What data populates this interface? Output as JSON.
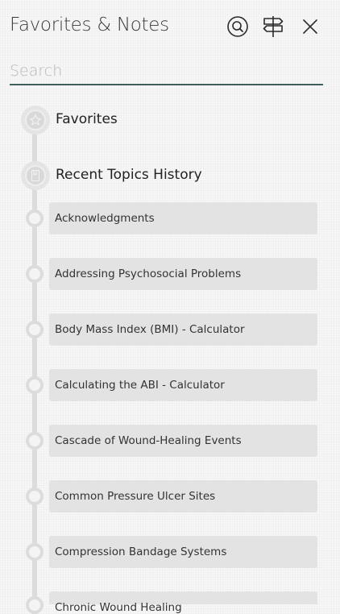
{
  "header": {
    "title": "Favorites & Notes",
    "icons": [
      "search-icon",
      "signpost-icon",
      "close-icon"
    ]
  },
  "search": {
    "placeholder": "Search",
    "value": ""
  },
  "sections": {
    "favorites": {
      "label": "Favorites",
      "icon": "star-icon"
    },
    "recent": {
      "label": "Recent Topics History",
      "icon": "bookmark-icon"
    }
  },
  "recent_items": [
    "Acknowledgments",
    "Addressing Psychosocial Problems",
    "Body Mass Index (BMI) - Calculator",
    "Calculating the ABI - Calculator",
    "Cascade of Wound-Healing Events",
    "Common Pressure Ulcer Sites",
    "Compression Bandage Systems",
    "Chronic Wound Healing"
  ],
  "colors": {
    "accent_underline": "#3f5f5a",
    "item_background": "#e3e3e3",
    "timeline": "#dcdcdc"
  }
}
